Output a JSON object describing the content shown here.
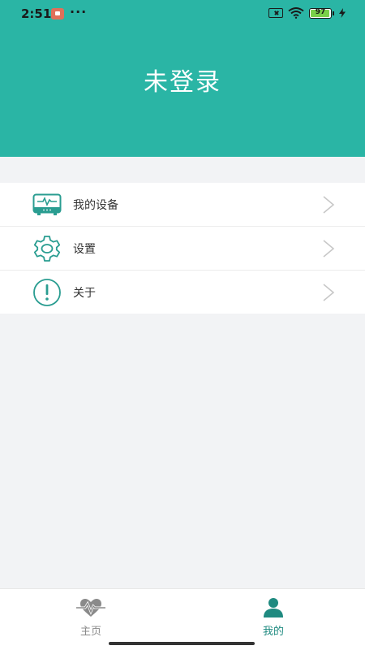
{
  "status_bar": {
    "time": "2:51",
    "dots": "···",
    "battery_level": "97",
    "battery_percent": 97
  },
  "header": {
    "title": "未登录"
  },
  "menu": {
    "items": [
      {
        "label": "我的设备",
        "icon": "device-monitor-icon"
      },
      {
        "label": "设置",
        "icon": "gear-icon"
      },
      {
        "label": "关于",
        "icon": "info-exclamation-icon"
      }
    ]
  },
  "bottom_nav": {
    "tabs": [
      {
        "label": "主页",
        "icon": "heartbeat-icon",
        "active": false
      },
      {
        "label": "我的",
        "icon": "person-icon",
        "active": true
      }
    ]
  },
  "colors": {
    "accent": "#2ab5a5",
    "icon": "#2a9d91",
    "active_tab": "#1f8a80",
    "inactive_tab": "#8a8a8a",
    "background": "#f2f3f5"
  }
}
